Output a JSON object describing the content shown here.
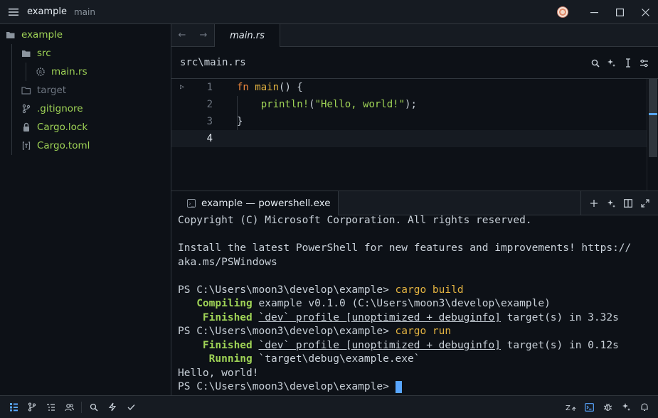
{
  "titlebar": {
    "project": "example",
    "branch": "main",
    "icons": [
      "hamburger-menu-icon",
      "avatar",
      "minimize-icon",
      "maximize-icon",
      "close-icon"
    ]
  },
  "sidebar": {
    "items": [
      {
        "label": "example",
        "icon": "folder-open-icon",
        "level": 0
      },
      {
        "label": "src",
        "icon": "folder-open-icon",
        "level": 1
      },
      {
        "label": "main.rs",
        "icon": "rust-file-icon",
        "level": 2
      },
      {
        "label": "target",
        "icon": "folder-icon",
        "level": 1
      },
      {
        "label": ".gitignore",
        "icon": "git-icon",
        "level": 1
      },
      {
        "label": "Cargo.lock",
        "icon": "lock-icon",
        "level": 1
      },
      {
        "label": "Cargo.toml",
        "icon": "toml-file-icon",
        "level": 1
      }
    ]
  },
  "editor": {
    "tab": "main.rs",
    "breadcrumb": "src\\main.rs",
    "lines": [
      {
        "num": "1"
      },
      {
        "num": "2"
      },
      {
        "num": "3"
      },
      {
        "num": "4"
      }
    ],
    "code": {
      "l1_kw": "fn",
      "l1_fn": "main",
      "l1_rest": "() {",
      "l2_macro": "println!",
      "l2_open": "(",
      "l2_str": "\"Hello, world!\"",
      "l2_close": ");",
      "l3": "}"
    }
  },
  "terminal": {
    "tab_title": "example — powershell.exe",
    "lines": {
      "copyright": "Copyright (C) Microsoft Corporation. All rights reserved.",
      "install1": "Install the latest PowerShell for new features and improvements! https://",
      "install2": "aka.ms/PSWindows",
      "prompt": "PS C:\\Users\\moon3\\develop\\example> ",
      "cmd_build": "cargo build",
      "compiling_label": "   Compiling",
      "compiling_text": " example v0.1.0 (C:\\Users\\moon3\\develop\\example)",
      "finished_label": "    Finished",
      "finished_profile": "`dev` profile [unoptimized + debuginfo]",
      "finished_time1": " target(s) in 3.32s",
      "cmd_run": "cargo run",
      "finished_time2": " target(s) in 0.12s",
      "running_label": "     Running",
      "running_text": " `target\\debug\\example.exe`",
      "hello": "Hello, world!"
    }
  },
  "colors": {
    "accent": "#58a6ff",
    "green": "#9fd356",
    "keyword": "#f0883e",
    "function": "#e3b341"
  }
}
